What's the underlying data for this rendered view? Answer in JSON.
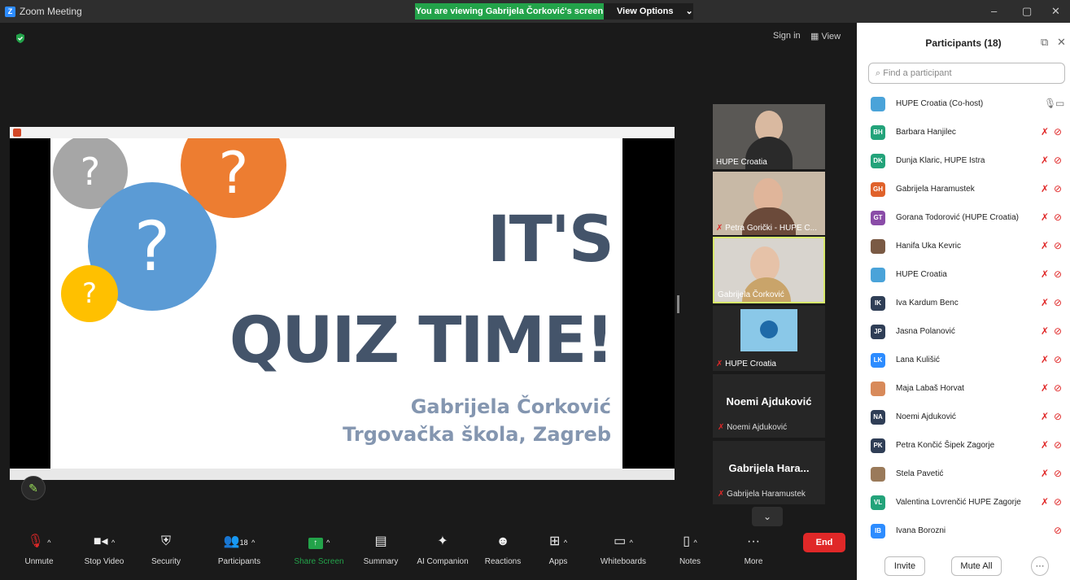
{
  "window": {
    "title": "Zoom Meeting",
    "viewing_banner": "You are viewing Gabrijela Čorković's screen",
    "view_options": "View Options",
    "minimize": "–",
    "maximize": "▢",
    "close": "✕"
  },
  "meeting": {
    "sign_in": "Sign in",
    "view": "View"
  },
  "slide": {
    "line1": "IT'S",
    "line2": "QUIZ TIME!",
    "author": "Gabrijela Čorković",
    "school": "Trgovačka škola, Zagreb",
    "qmark": "?",
    "bubble_colors": {
      "gray": "#a6a6a6",
      "orange": "#ed7d31",
      "blue": "#5b9bd5",
      "yellow": "#ffc000"
    }
  },
  "thumbnails": [
    {
      "label": "HUPE Croatia"
    },
    {
      "label": "Petra Gorički - HUPE C..."
    },
    {
      "label": "Gabrijela Čorković"
    },
    {
      "label": "HUPE Croatia"
    }
  ],
  "name_tiles": [
    {
      "big": "Noemi Ajduković",
      "small": "Noemi Ajduković"
    },
    {
      "big": "Gabrijela Hara...",
      "small": "Gabrijela Haramustek"
    }
  ],
  "toolbar": {
    "items": [
      {
        "label": "Unmute",
        "icon": "mic-muted-icon"
      },
      {
        "label": "Stop Video",
        "icon": "video-icon"
      },
      {
        "label": "Security",
        "icon": "shield-icon"
      },
      {
        "label": "Participants",
        "icon": "participants-icon",
        "count": "18"
      },
      {
        "label": "Share Screen",
        "icon": "share-screen-icon"
      },
      {
        "label": "Summary",
        "icon": "summary-icon"
      },
      {
        "label": "AI Companion",
        "icon": "sparkle-icon"
      },
      {
        "label": "Reactions",
        "icon": "emoji-icon"
      },
      {
        "label": "Apps",
        "icon": "apps-icon"
      },
      {
        "label": "Whiteboards",
        "icon": "whiteboard-icon"
      },
      {
        "label": "Notes",
        "icon": "notes-icon"
      },
      {
        "label": "More",
        "icon": "more-icon"
      }
    ],
    "end": "End"
  },
  "panel": {
    "title": "Participants (18)",
    "search_placeholder": "Find a participant",
    "participants": [
      {
        "initials": "",
        "name": "HUPE Croatia (Co-host)",
        "color": "#4aa3d9"
      },
      {
        "initials": "BH",
        "name": "Barbara Hanjilec",
        "color": "#23a37a"
      },
      {
        "initials": "DK",
        "name": "Dunja Klaric, HUPE Istra",
        "color": "#23a37a"
      },
      {
        "initials": "GH",
        "name": "Gabrijela Haramustek",
        "color": "#e0622b"
      },
      {
        "initials": "GT",
        "name": "Gorana Todorović (HUPE Croatia)",
        "color": "#8a4ca8"
      },
      {
        "initials": "",
        "name": "Hanifa Uka Kevric",
        "color": "#7a5a44"
      },
      {
        "initials": "",
        "name": "HUPE Croatia",
        "color": "#4aa3d9"
      },
      {
        "initials": "IK",
        "name": "Iva Kardum Benc",
        "color": "#2f3e56"
      },
      {
        "initials": "JP",
        "name": "Jasna Polanović",
        "color": "#2f3e56"
      },
      {
        "initials": "LK",
        "name": "Lana Kulišić",
        "color": "#2d8cff"
      },
      {
        "initials": "",
        "name": "Maja Labaš Horvat",
        "color": "#d88a5a"
      },
      {
        "initials": "NA",
        "name": "Noemi Ajduković",
        "color": "#2f3e56"
      },
      {
        "initials": "PK",
        "name": "Petra Končić Šipek Zagorje",
        "color": "#2f3e56"
      },
      {
        "initials": "",
        "name": "Stela Pavetić",
        "color": "#9a7a5a"
      },
      {
        "initials": "VL",
        "name": "Valentina Lovrenčić HUPE Zagorje",
        "color": "#23a37a"
      },
      {
        "initials": "IB",
        "name": "Ivana Borozni",
        "color": "#2d8cff"
      }
    ],
    "invite": "Invite",
    "mute_all": "Mute All",
    "more": "···"
  }
}
